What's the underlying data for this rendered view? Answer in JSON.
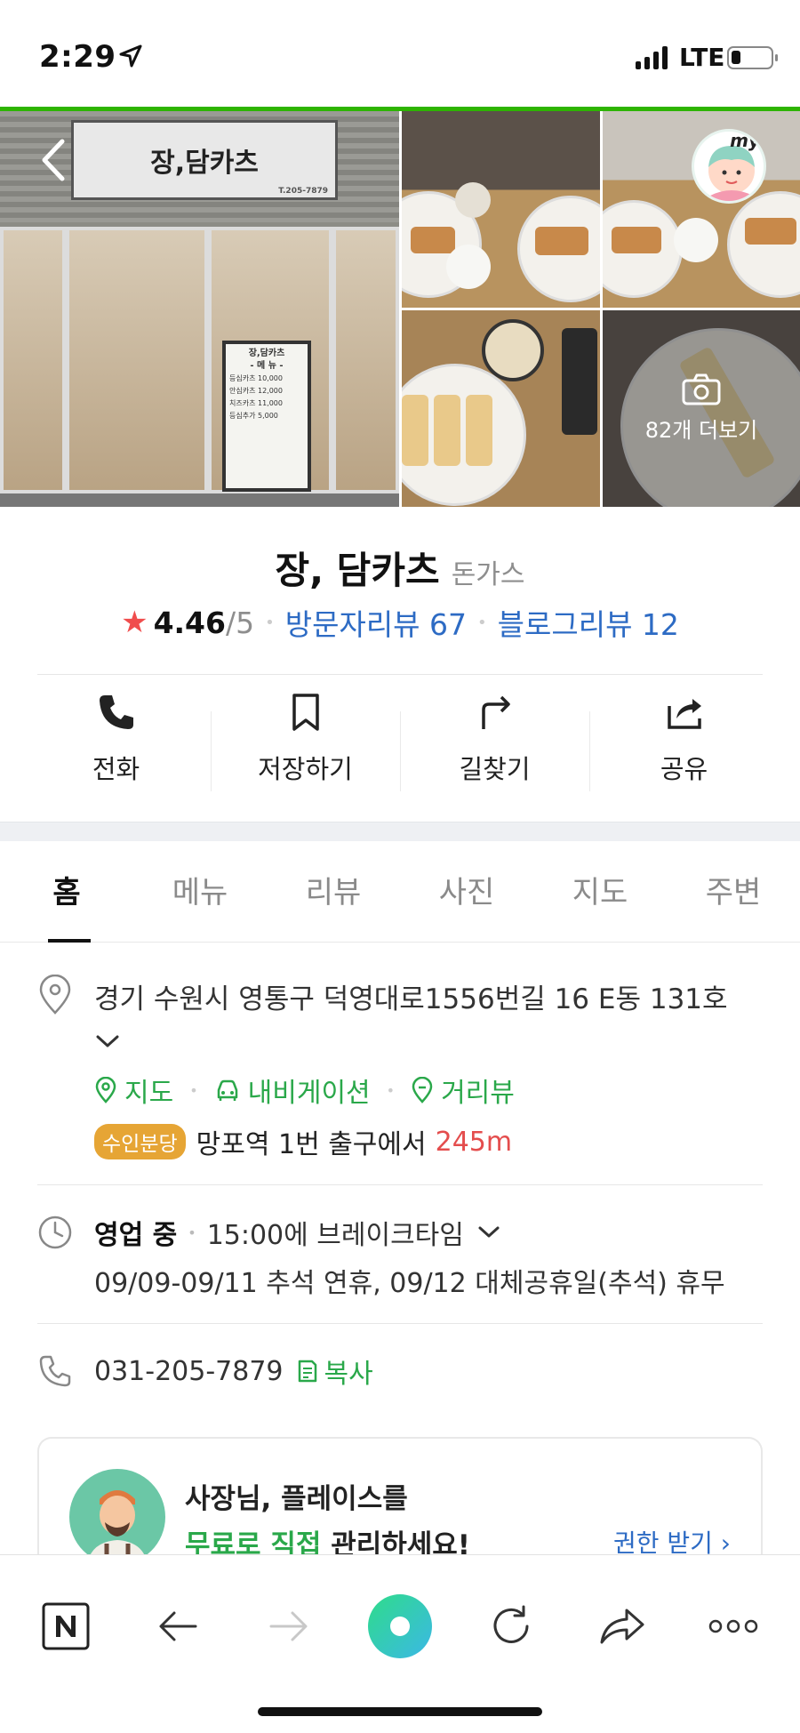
{
  "status_bar": {
    "time": "2:29",
    "network": "LTE"
  },
  "gallery": {
    "sign_text": "장,담카츠",
    "sign_phone": "T.205-7879",
    "menu_board": {
      "title": "장,담카츠",
      "heading": "- 메 뉴 -",
      "items": [
        "등심카츠  10,000",
        "안심카츠  12,000",
        "치즈카츠  11,000",
        "등심추가  5,000"
      ]
    },
    "more_photos_label": "82개 더보기",
    "my_badge": "my"
  },
  "place": {
    "name": "장, 담카츠",
    "category": "돈가스",
    "rating": "4.46",
    "rating_max": "/5",
    "visitor_reviews": "방문자리뷰 67",
    "blog_reviews": "블로그리뷰 12"
  },
  "actions": [
    {
      "label": "전화",
      "icon": "phone-icon"
    },
    {
      "label": "저장하기",
      "icon": "bookmark-icon"
    },
    {
      "label": "길찾기",
      "icon": "directions-icon"
    },
    {
      "label": "공유",
      "icon": "share-icon"
    }
  ],
  "tabs": [
    "홈",
    "메뉴",
    "리뷰",
    "사진",
    "지도",
    "주변"
  ],
  "active_tab": "홈",
  "info": {
    "address": "경기 수원시 영통구 덕영대로1556번길 16 E동 131호",
    "links": [
      "지도",
      "내비게이션",
      "거리뷰"
    ],
    "subway_line": "수인분당",
    "subway_text": "망포역 1번 출구에서",
    "subway_distance": "245m",
    "open_status": "영업 중",
    "break_time": "15:00에 브레이크타임",
    "holiday_notice": "09/09-09/11 추석 연휴, 09/12 대체공휴일(추석) 휴무",
    "phone": "031-205-7879",
    "copy_label": "복사"
  },
  "owner_banner": {
    "line1": "사장님, 플레이스를",
    "line2_highlight": "무료로 직접",
    "line2_rest": " 관리하세요!",
    "cta": "권한 받기 ›"
  },
  "colors": {
    "brand_green": "#2db400",
    "link_blue": "#2d6bc4",
    "action_green": "#2aa84a",
    "star_red": "#f04d4d",
    "subway_badge": "#e6a535"
  }
}
